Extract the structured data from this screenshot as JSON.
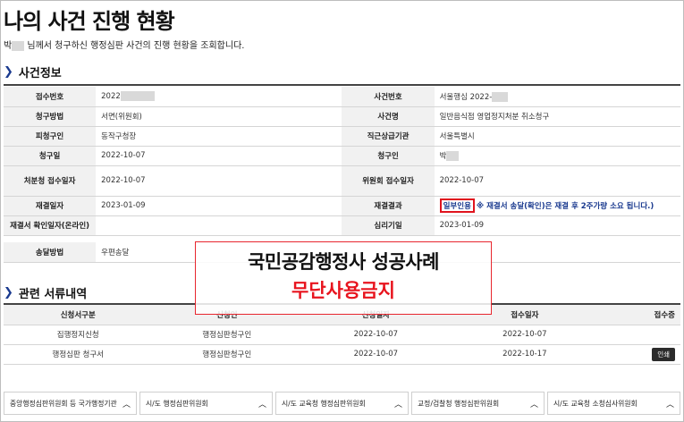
{
  "header": {
    "title": "나의 사건 진행 현황",
    "subtitle_prefix": "박",
    "subtitle_rest": "님께서 청구하신 행정심판 사건의 진행 현황을 조회합니다."
  },
  "case_info": {
    "heading": "사건정보",
    "rows": [
      {
        "l1": "접수번호",
        "v1": "2022",
        "l2": "사건번호",
        "v2": "서울행심 2022-"
      },
      {
        "l1": "청구방법",
        "v1": "서면(위원회)",
        "l2": "사건명",
        "v2": "일반음식점 영업정지처분 취소청구"
      },
      {
        "l1": "피청구인",
        "v1": "동작구청장",
        "l2": "직근상급기관",
        "v2": "서울특별시"
      },
      {
        "l1": "청구일",
        "v1": "2022-10-07",
        "l2": "청구인",
        "v2": "박"
      },
      {
        "l1": "처분청 접수일자",
        "v1": "2022-10-07",
        "l2": "위원회 접수일자",
        "v2": "2022-10-07"
      },
      {
        "l1": "재결일자",
        "v1": "2023-01-09",
        "l2": "재결결과",
        "v2": "일부인용",
        "note": "※ 재결서 송달(확인)은 재결 후 2주가량 소요 됩니다.)"
      },
      {
        "l1": "재결서 확인일자(온라인)",
        "v1": "",
        "l2": "심리기일",
        "v2": "2023-01-09"
      },
      {
        "l1": "송달방법",
        "v1": "우편송달",
        "l2": "",
        "v2": ""
      }
    ]
  },
  "watermark": {
    "line1": "국민공감행정사 성공사례",
    "line2": "무단사용금지"
  },
  "documents": {
    "heading": "관련 서류내역",
    "columns": [
      "신청서구분",
      "신청인",
      "신청일자",
      "접수일자",
      "접수증"
    ],
    "rows": [
      {
        "type": "집행정지신청",
        "applicant": "행정심판청구인",
        "applied": "2022-10-07",
        "received": "2022-10-07",
        "receipt": ""
      },
      {
        "type": "행정심판 청구서",
        "applicant": "행정심판청구인",
        "applied": "2022-10-07",
        "received": "2022-10-17",
        "receipt": "인쇄"
      }
    ]
  },
  "footer_links": [
    "중앙행정심판위원회 등 국가행정기관",
    "시/도 행정심판위원회",
    "시/도 교육청 행정심판위원회",
    "교정/검찰청 행정심판위원회",
    "시/도 교육청 소청심사위원회"
  ],
  "colors": {
    "accent_blue": "#1a3a8f",
    "warning_red": "#e8141e",
    "label_bg": "#f1f1f1"
  }
}
